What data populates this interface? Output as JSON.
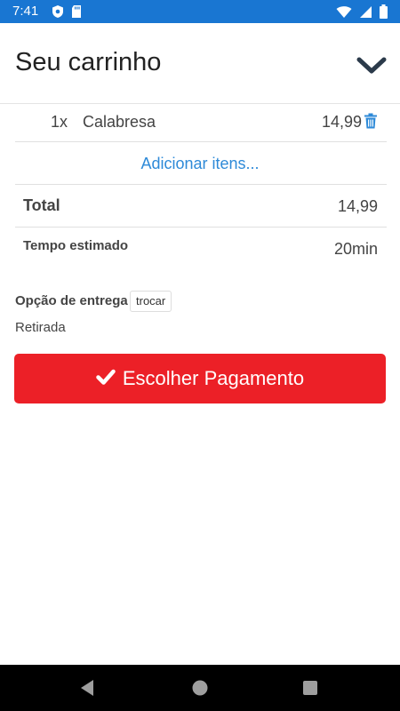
{
  "status_bar": {
    "time": "7:41",
    "icons": [
      "shield-icon",
      "sd-card-icon",
      "wifi-icon",
      "signal-icon",
      "battery-icon"
    ]
  },
  "header": {
    "title": "Seu carrinho",
    "collapse_icon": "chevron-down-icon"
  },
  "cart": {
    "items": [
      {
        "qty": "1x",
        "name": "Calabresa",
        "price": "14,99",
        "delete_icon": "trash-icon"
      }
    ],
    "add_items_label": "Adicionar itens..."
  },
  "summary": {
    "total_label": "Total",
    "total_value": "14,99",
    "time_label": "Tempo estimado",
    "time_value": "20min"
  },
  "delivery": {
    "label": "Opção de entrega",
    "swap_button": "trocar",
    "value": "Retirada"
  },
  "payment_button": {
    "label": "Escolher Pagamento",
    "icon": "check-icon",
    "color": "#ec2027"
  },
  "colors": {
    "status_bar": "#1976d2",
    "link": "#2e8ad8"
  },
  "nav_bar": {
    "icons": [
      "back-icon",
      "home-icon",
      "recents-icon"
    ]
  }
}
